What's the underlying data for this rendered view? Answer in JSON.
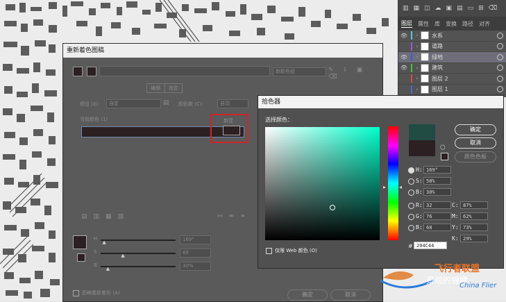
{
  "layers_panel": {
    "tabs": [
      "图层",
      "属性",
      "库",
      "变换",
      "路径",
      "对齐"
    ],
    "active_tab": "图层",
    "layers": [
      {
        "name": "水系",
        "color": "#4fc9d8",
        "visible": true,
        "selected": false
      },
      {
        "name": "道路",
        "color": "#9a5ad8",
        "visible": false,
        "selected": false
      },
      {
        "name": "绿地",
        "color": "#3e5bd8",
        "visible": true,
        "selected": true
      },
      {
        "name": "建筑",
        "color": "#3ec83e",
        "visible": true,
        "selected": false
      },
      {
        "name": "图层 2",
        "color": "#d84a4a",
        "visible": false,
        "selected": false
      },
      {
        "name": "图层 1",
        "color": "#4a68d8",
        "visible": false,
        "selected": false
      }
    ]
  },
  "recolor": {
    "title": "重新着色图稿",
    "preset_placeholder": "新颜色组",
    "tabs": [
      "编辑",
      "指定"
    ],
    "preset_label": "预设 (E):",
    "preset_value": "自定",
    "colors_label": "颜色数 (C):",
    "colors_value": "自动",
    "current_colors_label": "当前颜色 (1)",
    "new_label": "新建",
    "slider_letters": [
      "H",
      "S",
      "B"
    ],
    "slider_values": [
      "169°",
      "69",
      "30%"
    ],
    "recolor_checkbox": "图稿重新着色 (A)",
    "ok": "确定",
    "cancel": "取消"
  },
  "picker": {
    "title": "拾色器",
    "select_label": "选择颜色：",
    "ok": "确定",
    "cancel": "取消",
    "swatches": "颜色色板",
    "web_only": "仅限 Web 颜色 (O)",
    "hsb": [
      {
        "label": "H:",
        "value": "169°"
      },
      {
        "label": "S:",
        "value": "58%"
      },
      {
        "label": "B:",
        "value": "30%"
      }
    ],
    "rgb": [
      {
        "label": "R:",
        "value": "32"
      },
      {
        "label": "G:",
        "value": "76"
      },
      {
        "label": "B:",
        "value": "68"
      }
    ],
    "cmyk": [
      {
        "label": "C:",
        "value": "87%"
      },
      {
        "label": "M:",
        "value": "62%"
      },
      {
        "label": "Y:",
        "value": "73%"
      },
      {
        "label": "K:",
        "value": "29%"
      }
    ],
    "hex": "204C44",
    "new_color": "#204c44",
    "old_color": "#2d2022"
  },
  "watermark": {
    "brand": "飞行者联盟",
    "caption": "景观的锦鲤",
    "subtitle": "China Flier"
  }
}
